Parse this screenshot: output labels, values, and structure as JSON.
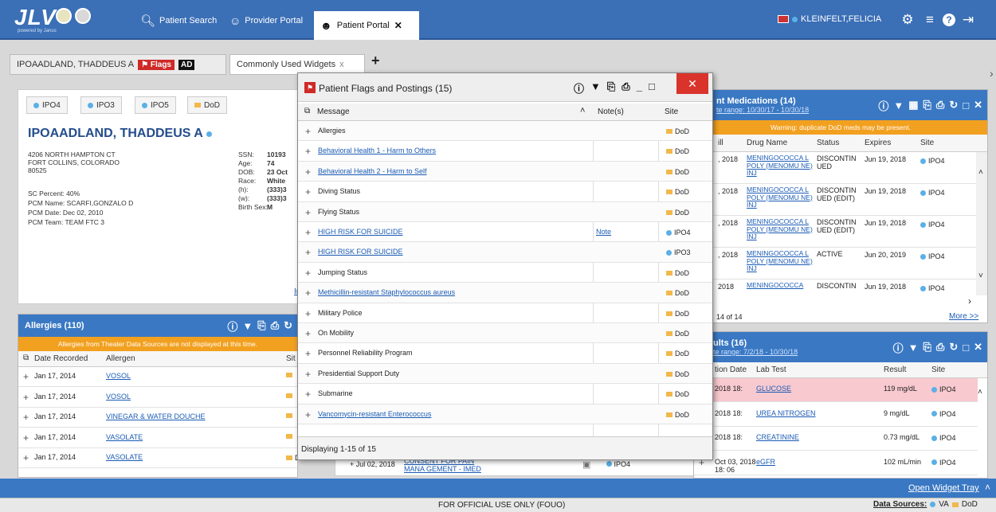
{
  "header": {
    "logo_text": "JLV",
    "logo_sub": "powered by Janus",
    "nav": {
      "patient_search": "Patient Search",
      "provider_portal": "Provider Portal",
      "patient_portal": "Patient Portal"
    },
    "user": "KLEINFELT,FELICIA",
    "close_glyph": "✕"
  },
  "patient_tabs": {
    "patient_name": "IPOAADLAND, THADDEUS A",
    "flags_label": "Flags",
    "ad_label": "AD",
    "widgets_tab": "Commonly Used Widgets",
    "widgets_close": "x",
    "add": "+"
  },
  "demographics": {
    "site_tabs": [
      "IPO4",
      "IPO3",
      "IPO5",
      "DoD"
    ],
    "name": "IPOAADLAND, THADDEUS A",
    "address": [
      "4206 NORTH HAMPTON CT",
      "FORT COLLINS, COLORADO",
      "80525"
    ],
    "pcm": [
      "SC Percent:  40%",
      "PCM Name:  SCARFI,GONZALO D",
      "PCM Date:  Dec 02, 2010",
      "PCM Team:  TEAM FTC 3"
    ],
    "fields": [
      {
        "label": "SSN:",
        "value": "10193"
      },
      {
        "label": "Age:",
        "value": "74"
      },
      {
        "label": "DOB:",
        "value": "23 Oct"
      },
      {
        "label": "Race:",
        "value": "White"
      },
      {
        "label": "(h):",
        "value": "(333)3"
      },
      {
        "label": "(w):",
        "value": "(333)3"
      },
      {
        "label": "Birth Sex:",
        "value": "M"
      }
    ],
    "link_partial": "Ins"
  },
  "allergies": {
    "title": "Allergies (110)",
    "warning": "Allergies from Theater Data Sources are not displayed at this time.",
    "cols": [
      "Date Recorded",
      "Allergen",
      "Sit"
    ],
    "rows": [
      {
        "date": "Jan 17, 2014",
        "allergen": "VOSOL"
      },
      {
        "date": "Jan 17, 2014",
        "allergen": "VOSOL"
      },
      {
        "date": "Jan 17, 2014",
        "allergen": "VINEGAR & WATER DOUCHE"
      },
      {
        "date": "Jan 17, 2014",
        "allergen": "VASOLATE"
      },
      {
        "date": "Jan 17, 2014",
        "allergen": "VASOLATE",
        "site": "DoD"
      }
    ]
  },
  "behind_row": {
    "date": "Jul 02, 2018",
    "text": "CONSENT FOR PAIN MANA GEMENT - IMED",
    "site": "IPO4"
  },
  "medications": {
    "title": "nt Medications (14)",
    "date_range": "te range: 10/30/17 - 10/30/18",
    "warning": "Warning: duplicate DoD meds may be present.",
    "cols": [
      "ill",
      "Drug Name",
      "Status",
      "Expires",
      "Site"
    ],
    "rows": [
      {
        "date": ", 2018",
        "drug": "MENINGOCOCCA L POLY (MENOMU NE) INJ",
        "status": "DISCONTIN UED",
        "expires": "Jun 19, 2018",
        "site": "IPO4"
      },
      {
        "date": ", 2018",
        "drug": "MENINGOCOCCA L POLY (MENOMU NE) INJ",
        "status": "DISCONTIN UED (EDIT)",
        "expires": "Jun 19, 2018",
        "site": "IPO4"
      },
      {
        "date": ", 2018",
        "drug": "MENINGOCOCCA L POLY (MENOMU NE) INJ",
        "status": "DISCONTIN UED (EDIT)",
        "expires": "Jun 19, 2018",
        "site": "IPO4"
      },
      {
        "date": ", 2018",
        "drug": "MENINGOCOCCA L POLY (MENOMU NE) INJ",
        "status": "ACTIVE",
        "expires": "Jun 20, 2019",
        "site": "IPO4"
      },
      {
        "date": "2018",
        "drug": "MENINGOCOCCA",
        "status": "DISCONTIN",
        "expires": "Jun 19, 2018",
        "site": "IPO4"
      }
    ],
    "count": "14 of 14",
    "more": "More >>"
  },
  "labs": {
    "title": "ults (16)",
    "date_range": "te range: 7/2/18 - 10/30/18",
    "cols": [
      "tion Date",
      "Lab Test",
      "Result",
      "Site"
    ],
    "rows": [
      {
        "date": "2018 18:",
        "test": "GLUCOSE",
        "result": "119 mg/dL",
        "site": "IPO4",
        "abnormal": true
      },
      {
        "date": "2018 18:",
        "test": "UREA NITROGEN",
        "result": "9 mg/dL",
        "site": "IPO4"
      },
      {
        "date": "2018 18:",
        "test": "CREATININE",
        "result": "0.73 mg/dL",
        "site": "IPO4"
      },
      {
        "date": "Oct 03, 2018 18: 06",
        "test": "eGFR",
        "result": "102 mL/min",
        "site": "IPO4"
      }
    ]
  },
  "modal": {
    "title": "Patient Flags and Postings (15)",
    "cols": {
      "message": "Message",
      "notes": "Note(s)",
      "site": "Site"
    },
    "rows": [
      {
        "message": "Allergies",
        "link": false,
        "note": "",
        "site": "DoD"
      },
      {
        "message": "Behavioral Health 1 - Harm to Others",
        "link": true,
        "note": "",
        "site": "DoD"
      },
      {
        "message": "Behavioral Health 2 - Harm to Self",
        "link": true,
        "note": "",
        "site": "DoD"
      },
      {
        "message": "Diving Status",
        "link": false,
        "note": "",
        "site": "DoD"
      },
      {
        "message": "Flying Status",
        "link": false,
        "note": "",
        "site": "DoD"
      },
      {
        "message": "HIGH RISK FOR SUICIDE",
        "link": true,
        "note": "Note",
        "site": "IPO4"
      },
      {
        "message": "HIGH RISK FOR SUICIDE",
        "link": true,
        "note": "",
        "site": "IPO3"
      },
      {
        "message": "Jumping Status",
        "link": false,
        "note": "",
        "site": "DoD"
      },
      {
        "message": "Methicillin-resistant Staphylococcus aureus",
        "link": true,
        "note": "",
        "site": "DoD"
      },
      {
        "message": "Military Police",
        "link": false,
        "note": "",
        "site": "DoD"
      },
      {
        "message": "On Mobility",
        "link": false,
        "note": "",
        "site": "DoD"
      },
      {
        "message": "Personnel Reliability Program",
        "link": false,
        "note": "",
        "site": "DoD"
      },
      {
        "message": "Presidential Support Duty",
        "link": false,
        "note": "",
        "site": "DoD"
      },
      {
        "message": "Submarine",
        "link": false,
        "note": "",
        "site": "DoD"
      },
      {
        "message": "Vancomycin-resistant Enterococcus",
        "link": true,
        "note": "",
        "site": "DoD"
      }
    ],
    "footer": "Displaying 1-15 of 15"
  },
  "footer": {
    "tray": "Open Widget Tray",
    "fouo": "FOR OFFICIAL USE ONLY (FOUO)",
    "sources_label": "Data Sources:",
    "sources": [
      "VA",
      "DoD"
    ]
  },
  "colors": {
    "va": "#5ab0e6",
    "dod": "#f2b84b",
    "header": "#3b6fb6",
    "flag": "#cf2a27"
  }
}
